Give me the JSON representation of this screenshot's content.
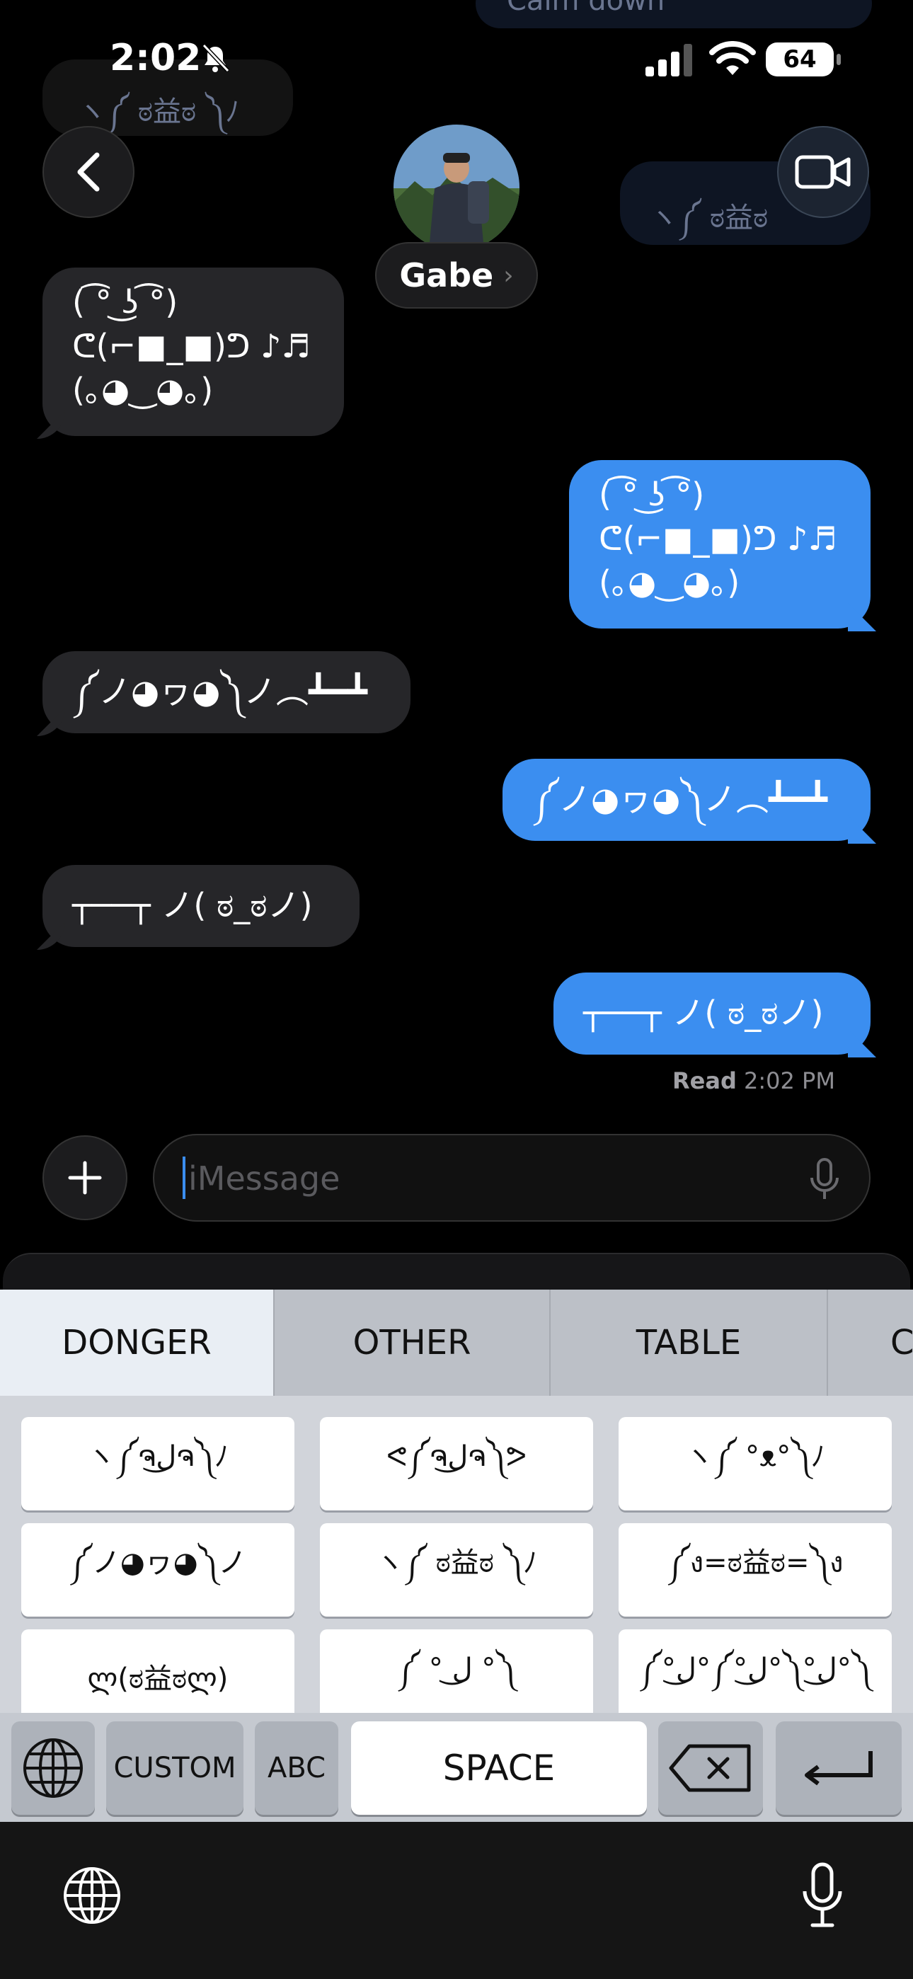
{
  "status_bar": {
    "time": "2:02",
    "battery": "64"
  },
  "background_ghosts": {
    "top_right": "Calm down",
    "left": "ヽ༼ ಠ益ಠ ༽ﾉ",
    "right": "ヽ༼ ಠ益ಠ"
  },
  "header": {
    "contact_name": "Gabe",
    "chevron": "›"
  },
  "messages": [
    {
      "direction": "incoming",
      "text": "( ͡° ͜ʖ ͡°)\nᕦ(⌐■_■)ᕤ ♪♬\n(｡◕‿◕｡)"
    },
    {
      "direction": "outgoing",
      "text": "( ͡° ͜ʖ ͡°)\nᕦ(⌐■_■)ᕤ ♪♬\n(｡◕‿◕｡)"
    },
    {
      "direction": "incoming",
      "text": "༼ノ◕ヮ◕༽ノ︵┻━┻"
    },
    {
      "direction": "outgoing",
      "text": "༼ノ◕ヮ◕༽ノ︵┻━┻"
    },
    {
      "direction": "incoming",
      "text": "┬──┬ ノ( ಠ_ಠノ)"
    },
    {
      "direction": "outgoing",
      "text": "┬──┬ ノ( ಠ_ಠノ)"
    }
  ],
  "receipt": {
    "label": "Read",
    "time": "2:02 PM"
  },
  "composer": {
    "placeholder": "iMessage"
  },
  "keyboard": {
    "tabs": [
      "DONGER",
      "OTHER",
      "TABLE",
      "C"
    ],
    "active_tab": "DONGER",
    "dongers": [
      "ヽ༼ຈل͜ຈ༽ﾉ",
      "ᕙ༼ຈل͜ຈ༽ᕗ",
      "ヽ༼ °ᴥ°༽ﾉ",
      "༼ノ◕ヮ◕༽ノ",
      "ヽ༼ ಠ益ಠ ༽ﾉ",
      "༼ง=ಠ益ಠ=༽ง",
      "ლ(ಠ益ಠლ)",
      "༼ ° ل͜ °༽",
      "༼°ل͜°༼°ل͜°༽°ل͜°༽"
    ],
    "custom_label": "CUSTOM",
    "abc_label": "ABC",
    "space_label": "SPACE"
  },
  "colors": {
    "outgoing": "#3b8ef0",
    "incoming": "#262629",
    "keyboard": "#d1d4da"
  }
}
